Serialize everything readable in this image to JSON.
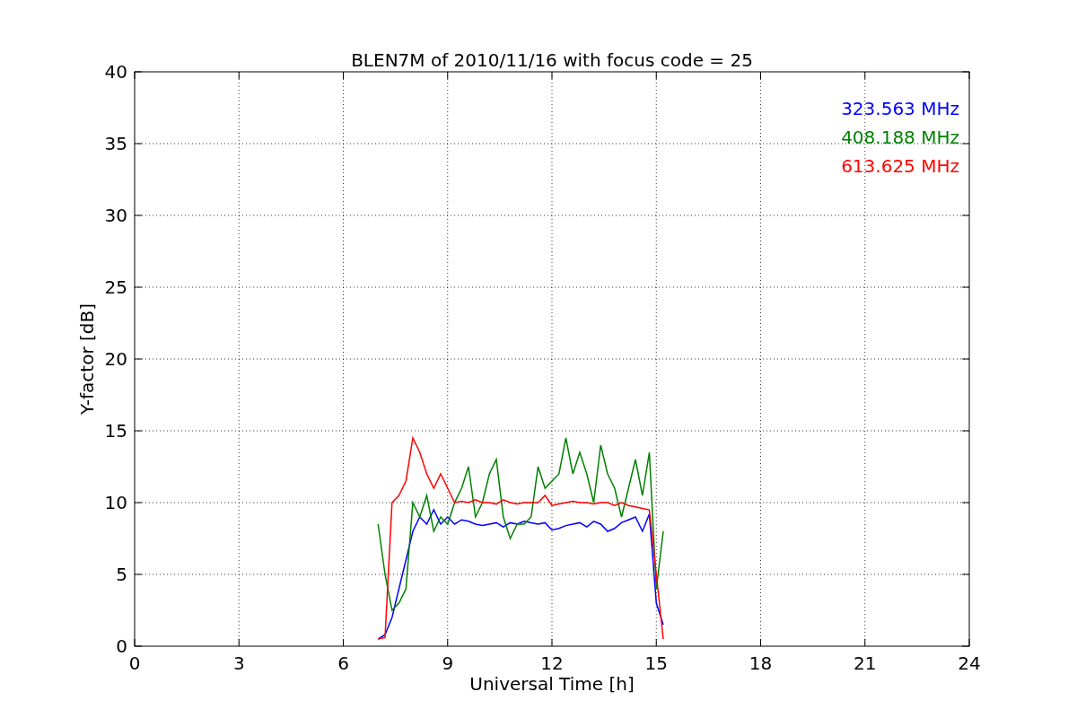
{
  "chart_data": {
    "type": "line",
    "title": "BLEN7M of 2010/11/16 with focus code = 25",
    "xlabel": "Universal Time [h]",
    "ylabel": "Y-factor [dB]",
    "x": [
      7.0,
      7.2,
      7.4,
      7.6,
      7.8,
      8.0,
      8.2,
      8.4,
      8.6,
      8.8,
      9.0,
      9.2,
      9.4,
      9.6,
      9.8,
      10.0,
      10.2,
      10.4,
      10.6,
      10.8,
      11.0,
      11.2,
      11.4,
      11.6,
      11.8,
      12.0,
      12.2,
      12.4,
      12.6,
      12.8,
      13.0,
      13.2,
      13.4,
      13.6,
      13.8,
      14.0,
      14.2,
      14.4,
      14.6,
      14.8,
      15.0,
      15.2
    ],
    "series": [
      {
        "name": "323.563 MHz",
        "color": "#0000ff",
        "values": [
          0.5,
          0.8,
          2,
          4,
          6,
          8,
          9,
          8.5,
          9.5,
          8.5,
          9,
          8.5,
          8.8,
          8.7,
          8.5,
          8.4,
          8.5,
          8.6,
          8.3,
          8.6,
          8.5,
          8.7,
          8.6,
          8.5,
          8.6,
          8.1,
          8.2,
          8.4,
          8.5,
          8.6,
          8.3,
          8.7,
          8.5,
          8.0,
          8.2,
          8.6,
          8.8,
          9.0,
          8.0,
          9.2,
          3,
          1.5
        ]
      },
      {
        "name": "408.188 MHz",
        "color": "#008000",
        "values": [
          8.5,
          5,
          2.5,
          3,
          4,
          10,
          9,
          10.5,
          8,
          9,
          8.5,
          10,
          11,
          12.5,
          9,
          10,
          12,
          13,
          9,
          7.5,
          8.5,
          8.5,
          9,
          12.5,
          11,
          11.5,
          12,
          14.5,
          12,
          13.5,
          12,
          10,
          14,
          12,
          11,
          9,
          11,
          13,
          10.5,
          13.5,
          4,
          8
        ]
      },
      {
        "name": "613.625 MHz",
        "color": "#ff0000",
        "values": [
          0.5,
          0.6,
          10,
          10.5,
          11.5,
          14.5,
          13.5,
          12,
          11,
          12,
          11,
          10,
          10.1,
          10,
          10.2,
          10,
          10,
          9.9,
          10.2,
          10,
          9.9,
          10,
          10,
          10,
          10.5,
          9.8,
          9.9,
          10,
          10.1,
          10,
          10,
          9.9,
          10,
          10,
          9.8,
          10,
          9.8,
          9.7,
          9.6,
          9.5,
          5,
          0.5
        ]
      }
    ],
    "xlim": [
      0,
      24
    ],
    "ylim": [
      0,
      40
    ],
    "xticks": [
      0,
      3,
      6,
      9,
      12,
      15,
      18,
      21,
      24
    ],
    "yticks": [
      0,
      5,
      10,
      15,
      20,
      25,
      30,
      35,
      40
    ],
    "grid": true
  }
}
